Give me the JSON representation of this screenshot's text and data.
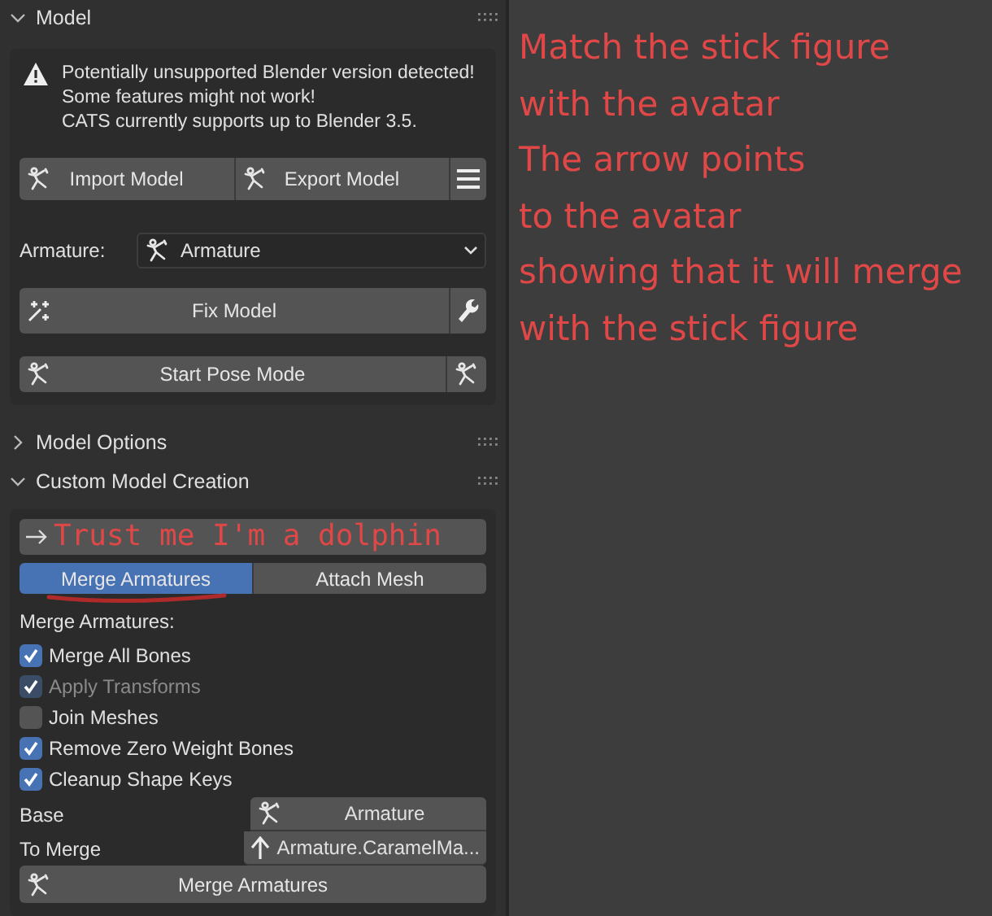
{
  "model_panel": {
    "title": "Model",
    "expanded": true,
    "warning": [
      "Potentially unsupported Blender version detected!",
      "Some features might not work!",
      "CATS currently supports up to Blender 3.5."
    ],
    "import_button": "Import Model",
    "export_button": "Export Model",
    "armature_label": "Armature:",
    "armature_value": "Armature",
    "fix_button": "Fix Model",
    "pose_button": "Start Pose Mode"
  },
  "model_options": {
    "title": "Model Options",
    "expanded": false
  },
  "custom_panel": {
    "title": "Custom Model Creation",
    "expanded": true,
    "annotation": "Trust me I'm a dolphin",
    "tabs": [
      {
        "label": "Merge Armatures",
        "selected": true
      },
      {
        "label": "Attach Mesh",
        "selected": false
      }
    ],
    "section_label": "Merge Armatures:",
    "options": [
      {
        "label": "Merge All Bones",
        "checked": true,
        "disabled": false
      },
      {
        "label": "Apply Transforms",
        "checked": true,
        "disabled": true
      },
      {
        "label": "Join Meshes",
        "checked": false,
        "disabled": false
      },
      {
        "label": "Remove Zero Weight Bones",
        "checked": true,
        "disabled": false
      },
      {
        "label": "Cleanup Shape Keys",
        "checked": true,
        "disabled": false
      }
    ],
    "base_label": "Base",
    "base_value": "Armature",
    "merge_label": "To Merge",
    "merge_value": "Armature.CaramelMa...",
    "merge_button": "Merge Armatures"
  },
  "annotation_lines": [
    "Match the stick figure",
    "with the avatar",
    "The arrow points",
    "to the avatar",
    "showing that it will merge",
    "with the stick figure"
  ]
}
